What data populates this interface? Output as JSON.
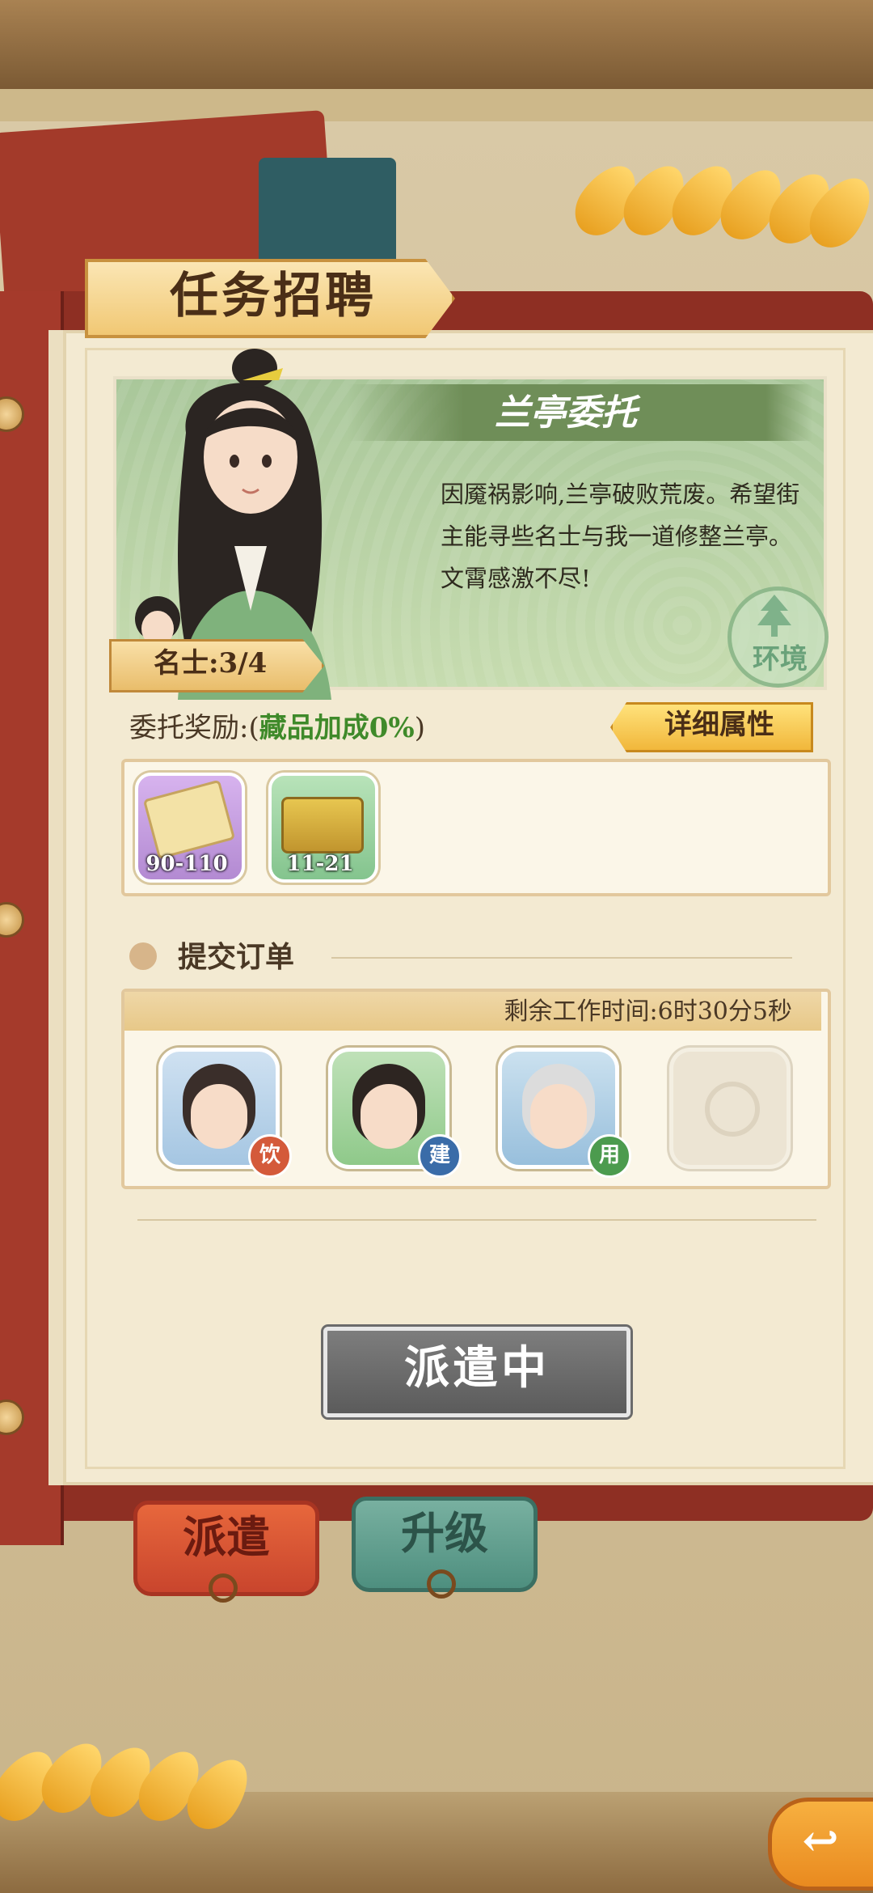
{
  "header": {
    "title": "任务招聘"
  },
  "commission": {
    "title": "兰亭委托",
    "description_lines": [
      "因魇祸影响,兰亭破败荒废。希望街",
      "主能寻些名士与我一道修整兰亭。",
      "文霄感激不尽!"
    ],
    "category_badge": "环境",
    "scholar_count_label": "名士:3/4"
  },
  "rewards": {
    "label_prefix": "委托奖励:(",
    "bonus_text": "藏品加成0%",
    "label_suffix": ")",
    "detail_button": "详细属性",
    "items": [
      {
        "name": "scroll-reward",
        "range": "90-110"
      },
      {
        "name": "chest-reward",
        "range": "11-21"
      }
    ]
  },
  "orders": {
    "section_title": "提交订单",
    "remaining_time": "剩余工作时间:6时30分5秒",
    "slots": [
      {
        "badge": "饮",
        "badge_color": "#d45a3a"
      },
      {
        "badge": "建",
        "badge_color": "#3a6ca8"
      },
      {
        "badge": "用",
        "badge_color": "#4c9b4e"
      },
      {
        "badge": "",
        "badge_color": ""
      }
    ]
  },
  "dispatch_button": "派遣中",
  "tabs": [
    {
      "label": "派遣",
      "color": "#e7673c"
    },
    {
      "label": "升级",
      "color": "#78b0a0"
    }
  ],
  "back_icon": "back-arrow-icon"
}
